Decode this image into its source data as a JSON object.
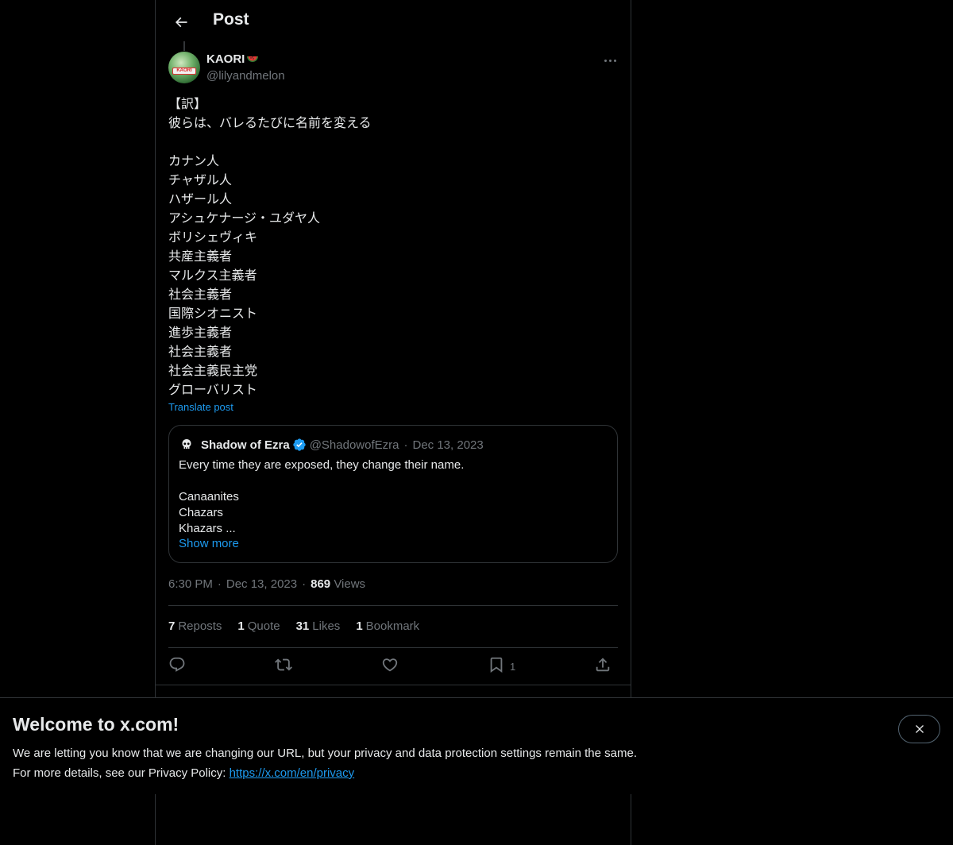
{
  "header": {
    "title": "Post"
  },
  "post": {
    "display_name": "KAORI",
    "handle": "@lilyandmelon",
    "avatar_text": "KAORI",
    "text": "【訳】\n彼らは、バレるたびに名前を変える\n\nカナン人\nチャザル人\nハザール人\nアシュケナージ・ユダヤ人\nボリシェヴィキ\n共産主義者\nマルクス主義者\n社会主義者\n国際シオニスト\n進歩主義者\n社会主義者\n社会主義民主党\nグローバリスト",
    "translate_label": "Translate post",
    "time": "6:30 PM",
    "date": "Dec 13, 2023",
    "views_count": "869",
    "views_label": "Views"
  },
  "quote": {
    "display_name": "Shadow of Ezra",
    "handle": "@ShadowofEzra",
    "dot": "·",
    "date": "Dec 13, 2023",
    "text": "Every time they are exposed, they change their name.\n\nCanaanites\nChazars\nKhazars ...",
    "show_more": "Show more"
  },
  "stats": {
    "reposts_count": "7",
    "reposts_label": "Reposts",
    "quote_count": "1",
    "quote_label": "Quote",
    "likes_count": "31",
    "likes_label": "Likes",
    "bookmark_count": "1",
    "bookmark_label": "Bookmark"
  },
  "actions": {
    "bookmark_count": "1"
  },
  "banner": {
    "title": "Welcome to x.com!",
    "line1": "We are letting you know that we are changing our URL, but your privacy and data protection settings remain the same.",
    "line2": "For more details, see our Privacy Policy: ",
    "link": "https://x.com/en/privacy"
  },
  "colors": {
    "accent": "#1d9bf0",
    "background": "#000000",
    "text": "#e7e9ea",
    "muted": "#71767b",
    "border": "#2f3336"
  },
  "icons": [
    "back-arrow-icon",
    "melon-icon",
    "more-icon",
    "verified-icon",
    "reply-icon",
    "repost-icon",
    "like-icon",
    "bookmark-icon",
    "share-icon",
    "close-icon"
  ]
}
